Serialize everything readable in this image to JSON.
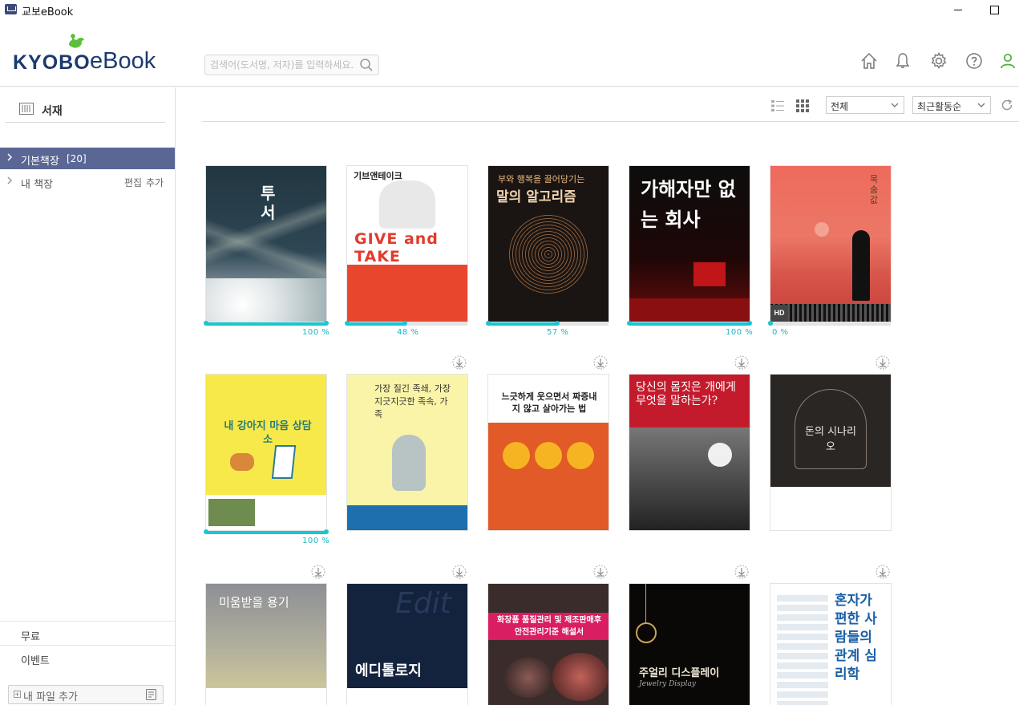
{
  "window": {
    "title": "교보eBook"
  },
  "header": {
    "logo_kyobo": "KYOBO",
    "logo_ebook": "eBook",
    "search_placeholder": "검색어(도서명, 저자)를 입력하세요.",
    "icons": [
      "home-icon",
      "bell-icon",
      "gear-icon",
      "help-icon",
      "user-icon"
    ]
  },
  "sidebar": {
    "section": "서재",
    "items": [
      {
        "label": "기본책장",
        "count": "[20]",
        "active": true
      },
      {
        "label": "내 책장",
        "actions": [
          "편집",
          "추가"
        ],
        "active": false
      }
    ],
    "bottom": [
      "무료",
      "이벤트"
    ],
    "add_file": "내 파일 추가"
  },
  "toolbar": {
    "filter": "전체",
    "sort": "최근활동순"
  },
  "books": [
    {
      "title": "투서",
      "progress": 100,
      "progress_label": "100 %"
    },
    {
      "title": "기브앤테이크",
      "cover_line": "GIVE and TAKE",
      "progress": 48,
      "progress_label": "48 %"
    },
    {
      "title": "말의 알고리즘",
      "subtitle": "부와 행복을 끌어당기는",
      "progress": 57,
      "progress_label": "57 %"
    },
    {
      "title": "가해자만 없는 회사",
      "progress": 100,
      "progress_label": "100 %"
    },
    {
      "title": "목숨 값",
      "hd": "HD",
      "progress": 0,
      "progress_label": "0 %"
    },
    {
      "title": "내 강아지 마음 상담소",
      "progress": 100,
      "progress_label": "100 %"
    },
    {
      "title": "가장 질긴 족쇄, 가장 지긋지긋한 족속, 가족"
    },
    {
      "title": "느긋하게 웃으면서 짜증내지 않고 살아가는 법"
    },
    {
      "title": "당신의 몸짓은 개에게 무엇을 말하는가?"
    },
    {
      "title": "돈의 시나리오"
    },
    {
      "title": "미움받을 용기"
    },
    {
      "title": "에디톨로지"
    },
    {
      "title": "화장품 품질관리 및 제조판매후 안전관리기준 해설서"
    },
    {
      "title": "주얼리 디스플레이",
      "subtitle": "Jewelry Display"
    },
    {
      "title": "혼자가 편한 사람들의 관계 심리학"
    }
  ]
}
